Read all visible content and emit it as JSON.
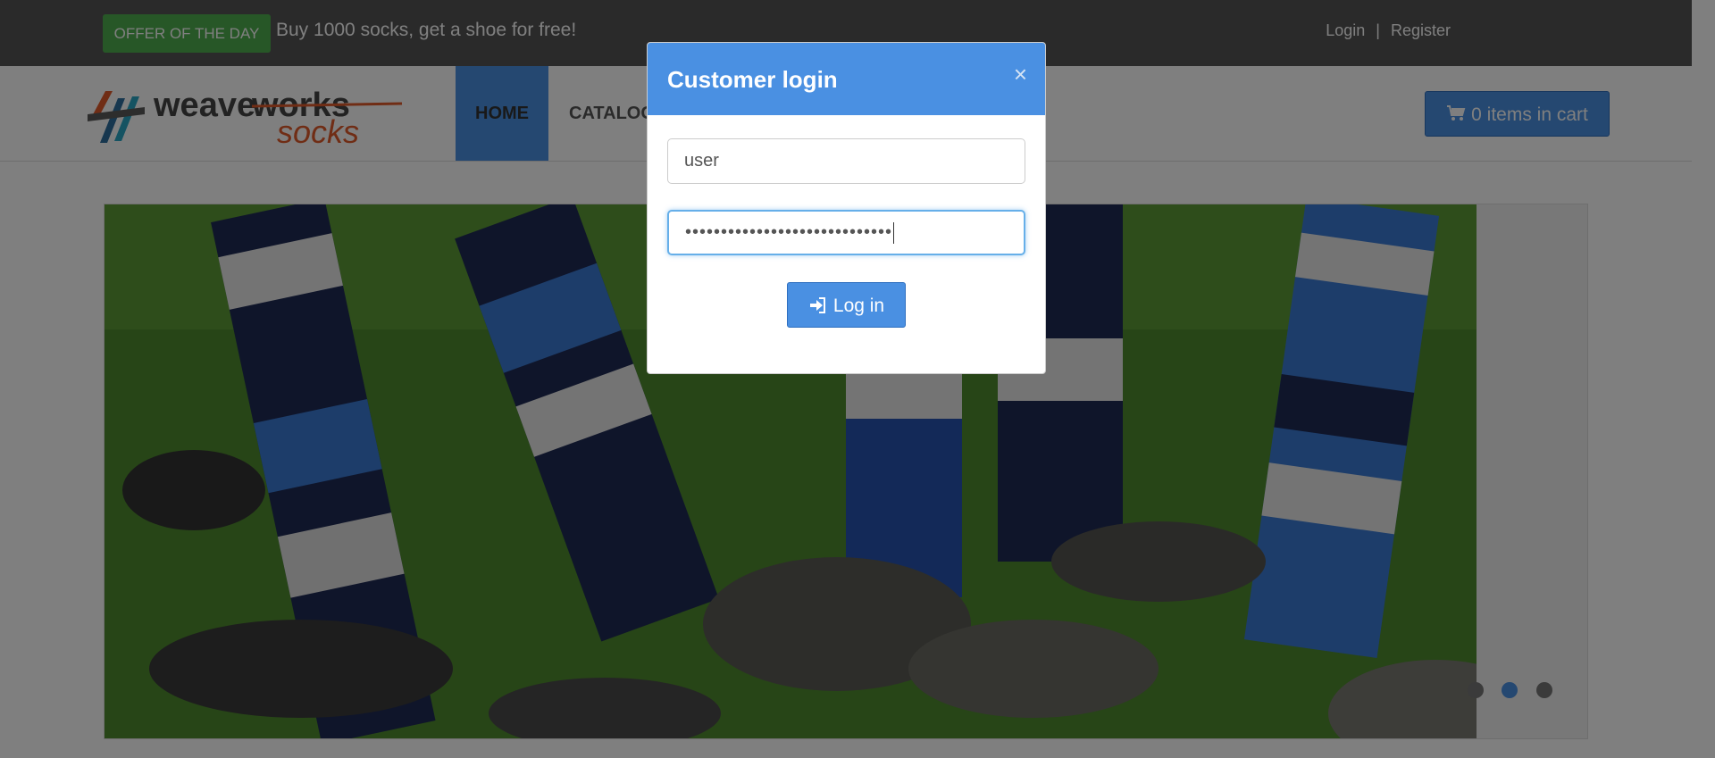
{
  "topbar": {
    "offer_badge": "OFFER OF THE DAY",
    "offer_text": "Buy 1000 socks, get a shoe for free!",
    "login_link": "Login",
    "separator": "|",
    "register_link": "Register"
  },
  "logo": {
    "word1": "weave",
    "word2": "works",
    "word3": "socks"
  },
  "nav": {
    "home": "HOME",
    "catalogue": "CATALOG"
  },
  "cart": {
    "icon": "shopping-cart-icon",
    "label": "0 items in cart"
  },
  "carousel": {
    "image": "soccer-players-legs-in-striped-socks",
    "dots_count": 3,
    "active_dot": 2
  },
  "modal": {
    "title": "Customer login",
    "close_symbol": "×",
    "username_value": "user",
    "password_value": "•••••••••••••••••••••••••••••",
    "login_button": "Log in",
    "login_icon": "sign-in-icon"
  },
  "colors": {
    "brand_blue": "#4a90e2",
    "offer_green": "#4fae4f",
    "topbar": "#555555",
    "logo_grey": "#444444",
    "logo_red": "#e05a2b"
  }
}
